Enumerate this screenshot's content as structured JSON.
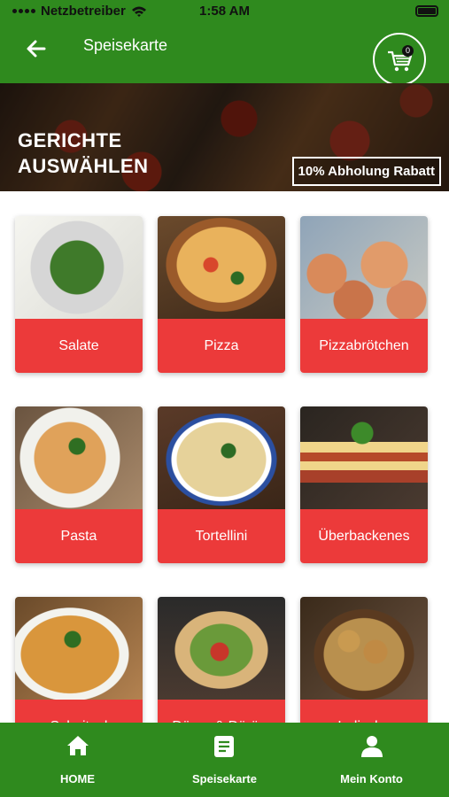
{
  "status_bar": {
    "carrier": "Netzbetreiber",
    "time": "1:58 AM"
  },
  "header": {
    "title": "Speisekarte",
    "cart_count": "0"
  },
  "banner": {
    "title_line1": "GERICHTE",
    "title_line2": "AUSWÄHLEN",
    "badge": "10% Abholung Rabatt"
  },
  "categories": [
    {
      "label": "Salate"
    },
    {
      "label": "Pizza"
    },
    {
      "label": "Pizzabrötchen"
    },
    {
      "label": "Pasta"
    },
    {
      "label": "Tortellini"
    },
    {
      "label": "Überbackenes"
    },
    {
      "label": "Schnitzel"
    },
    {
      "label": "Döner & Dürüm"
    },
    {
      "label": "Indische"
    }
  ],
  "bottom_nav": [
    {
      "label": "HOME",
      "icon": "home-icon"
    },
    {
      "label": "Speisekarte",
      "icon": "menu-document-icon"
    },
    {
      "label": "Mein Konto",
      "icon": "account-icon"
    }
  ],
  "colors": {
    "primary_green": "#2f8a1e",
    "card_red": "#ec3a3a"
  }
}
